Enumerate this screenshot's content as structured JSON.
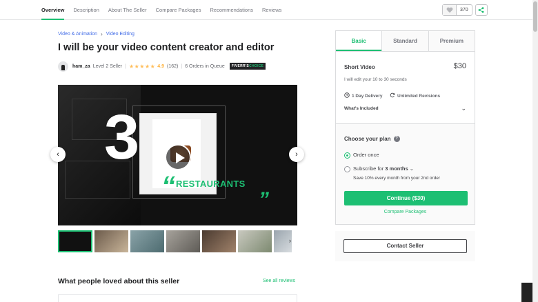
{
  "nav": {
    "tabs": [
      "Overview",
      "Description",
      "About The Seller",
      "Compare Packages",
      "Recommendations",
      "Reviews"
    ],
    "like_count": "370",
    "icons": {
      "like": "heart-icon",
      "share": "share-icon"
    }
  },
  "breadcrumb": {
    "items": [
      "Video & Animation",
      "Video Editing"
    ]
  },
  "gig": {
    "title": "I will be your video content creator and editor"
  },
  "seller": {
    "name": "ham_za",
    "level": "Level 2 Seller",
    "rating": "4.9",
    "reviews": "(162)",
    "queue": "6 Orders in Queue",
    "badge_prefix": "FIVERR'S",
    "badge_suffix": "CHOICE"
  },
  "gallery": {
    "slide_number": "3",
    "slide_word": "RESTAURANTS",
    "prev_arrow": "‹",
    "next_arrow": "›",
    "thumb_next": "›",
    "thumb_count": 7,
    "selected_thumb": 0,
    "colors": {
      "accent": "#1dbf73"
    }
  },
  "reviews_section": {
    "heading": "What people loved about this seller",
    "see_all": "See all reviews"
  },
  "packages": {
    "tabs": [
      "Basic",
      "Standard",
      "Premium"
    ],
    "active_tab": "Basic",
    "name": "Short Video",
    "price": "$30",
    "description": "I will edit your 10 to 30 seconds",
    "delivery": "1 Day Delivery",
    "revisions": "Unlimited Revisions",
    "included_label": "What's Included",
    "choose_label": "Choose your plan",
    "option_once": "Order once",
    "option_subscribe_prefix": "Subscribe for",
    "option_subscribe_value": "3 months",
    "save_note": "Save 10% every month from your 2nd order",
    "selected_option": "Order once",
    "continue_label": "Continue ($30)",
    "compare_label": "Compare Packages"
  },
  "contact": {
    "label": "Contact Seller"
  }
}
